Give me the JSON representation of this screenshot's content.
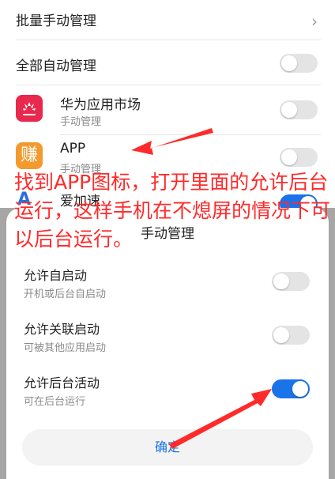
{
  "list": {
    "batch_manage": "批量手动管理",
    "all_auto_manage": "全部自动管理",
    "apps": [
      {
        "name": "华为应用市场",
        "status": "手动管理",
        "icon": "huawei-appgallery-icon",
        "icon_color": "#e8284d"
      },
      {
        "name": "APP",
        "status": "手动管理",
        "icon": "zhuan-app-icon",
        "icon_color": "#f29a2e",
        "icon_glyph": "赚"
      },
      {
        "name": "爱加速",
        "icon": "aijiasu-icon",
        "icon_glyph": "A"
      }
    ]
  },
  "annotation": {
    "text": "找到APP图标，打开里面的允许后台运行，这样手机在不熄屏的情况下可以后台运行。",
    "color": "#ff2a2a"
  },
  "dialog": {
    "title": "手动管理",
    "options": [
      {
        "label": "允许自启动",
        "desc": "开机或后台自启动",
        "enabled": false
      },
      {
        "label": "允许关联启动",
        "desc": "可被其他应用启动",
        "enabled": false
      },
      {
        "label": "允许后台活动",
        "desc": "可在后台运行",
        "enabled": true
      }
    ],
    "confirm_label": "确定"
  },
  "colors": {
    "accent": "#1a73e8",
    "toggle_off": "#e4e4e4"
  }
}
